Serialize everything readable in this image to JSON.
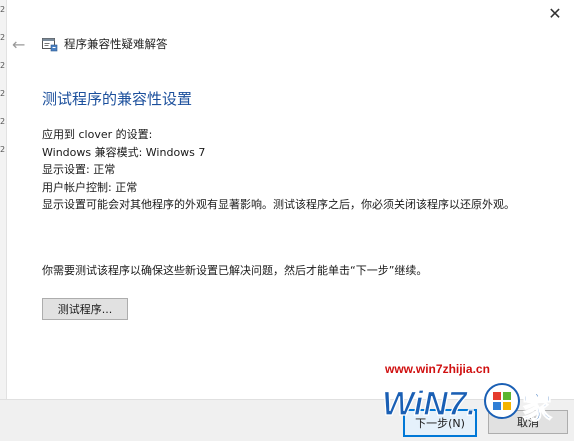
{
  "window": {
    "app_title": "程序兼容性疑难解答",
    "close_symbol": "✕",
    "back_symbol": "←"
  },
  "content": {
    "page_title": "测试程序的兼容性设置",
    "applied_to": "应用到  clover 的设置:",
    "compat_mode": "Windows 兼容模式: Windows 7",
    "display_settings": "显示设置: 正常",
    "uac": "用户帐户控制: 正常",
    "note": "显示设置可能会对其他程序的外观有显著影响。测试该程序之后，你必须关闭该程序以还原外观。",
    "instruction": "你需要测试该程序以确保这些新设置已解决问题，然后才能单击“下一步”继续。",
    "test_button": "测试程序..."
  },
  "footer": {
    "next_button": "下一步(N)",
    "cancel_button": "取消"
  },
  "left_edge": {
    "glyphs": [
      "2",
      "2",
      "2",
      "2",
      "2",
      "2"
    ]
  },
  "watermark": {
    "url": "www.win7zhijia.cn",
    "logo_text": "WiN7.",
    "logo_char": "家"
  },
  "colors": {
    "title_blue": "#1b4f9c",
    "accent": "#0078d7",
    "watermark_red": "#d01010",
    "watermark_blue": "#1a5fb4"
  }
}
